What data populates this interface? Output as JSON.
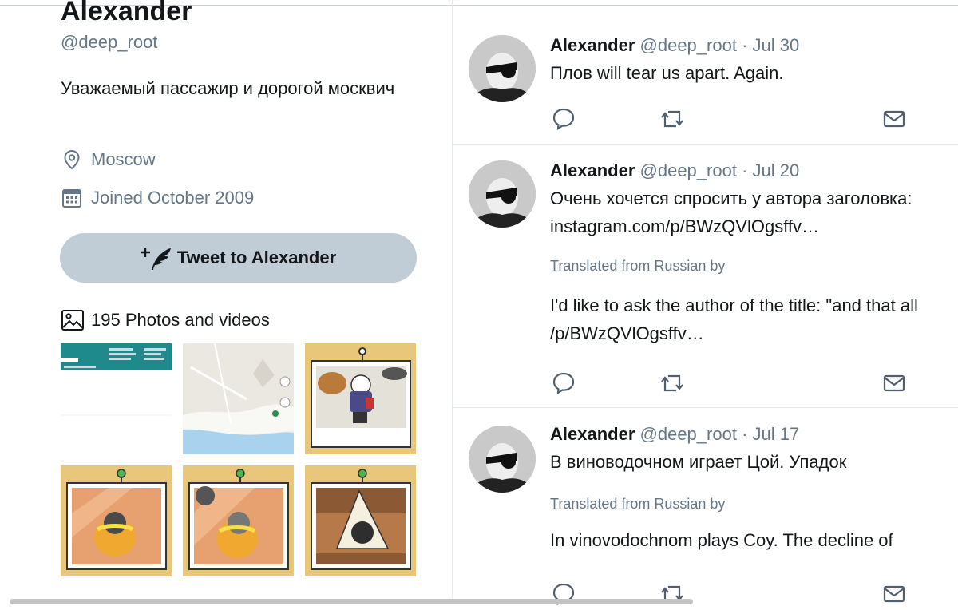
{
  "profile": {
    "name": "Alexander",
    "handle": "@deep_root",
    "bio": "Уважаемый пассажир и дорогой москвич",
    "location": "Moscow",
    "joined": "Joined October 2009",
    "tweet_button": "Tweet to Alexander",
    "photos_label": "195 Photos and videos"
  },
  "timeline": [
    {
      "name": "Alexander",
      "handle": "@deep_root",
      "date": "· Jul 30",
      "lines": [
        "Плов will tear us apart. Again."
      ]
    },
    {
      "name": "Alexander",
      "handle": "@deep_root",
      "date": "· Jul 20",
      "lines": [
        "Очень хочется спросить у автора заголовка:",
        "instagram.com/p/BWzQVlOgsffv…"
      ],
      "translated_label": "Translated from Russian by",
      "translation": [
        "I'd like to ask the author of the title: \"and that all",
        "/p/BWzQVlOgsffv…"
      ]
    },
    {
      "name": "Alexander",
      "handle": "@deep_root",
      "date": "· Jul 17",
      "lines": [
        "В виноводочном играет Цой. Упадок"
      ],
      "translated_label": "Translated from Russian by",
      "translation": [
        "In vinovodochnom plays Coy. The decline of"
      ]
    }
  ],
  "icons": {
    "location": "location-pin-icon",
    "calendar": "calendar-icon",
    "compose": "compose-quill-icon",
    "photos": "image-icon",
    "reply": "reply-icon",
    "retweet": "retweet-icon",
    "message": "envelope-icon"
  },
  "colors": {
    "text": "#14171a",
    "secondary": "#657786",
    "button_bg": "#c0ccd6",
    "divider": "#e6ecf0"
  }
}
